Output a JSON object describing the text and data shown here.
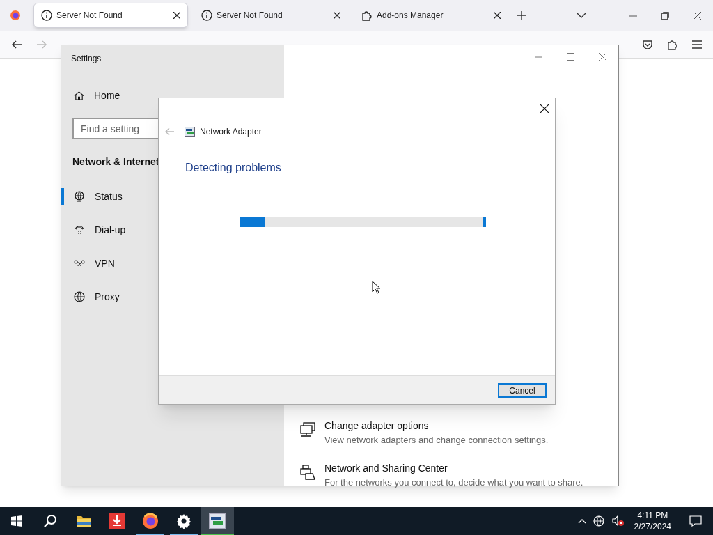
{
  "browser": {
    "tabs": [
      {
        "title": "Server Not Found",
        "kind": "info",
        "selected": true
      },
      {
        "title": "Server Not Found",
        "kind": "info",
        "selected": false
      },
      {
        "title": "Add-ons Manager",
        "kind": "puzzle",
        "selected": false
      }
    ]
  },
  "settings": {
    "title": "Settings",
    "home": "Home",
    "search": {
      "placeholder": "Find a setting"
    },
    "section": "Network & Internet",
    "items": [
      {
        "label": "Status",
        "kind": "globe-monitor",
        "selected": true
      },
      {
        "label": "Dial-up",
        "kind": "phone",
        "selected": false
      },
      {
        "label": "VPN",
        "kind": "vpn",
        "selected": false
      },
      {
        "label": "Proxy",
        "kind": "globe",
        "selected": false
      }
    ],
    "links": [
      {
        "title": "Change adapter options",
        "description": "View network adapters and change connection settings.",
        "kind": "monitors"
      },
      {
        "title": "Network and Sharing Center",
        "description": "For the networks you connect to, decide what you want to share.",
        "kind": "printer"
      }
    ]
  },
  "dialog": {
    "title": "Network Adapter",
    "heading": "Detecting problems",
    "progress": {
      "level": 0.1
    },
    "button": "Cancel"
  },
  "taskbar": {
    "apps": [
      {
        "kind": "folder",
        "running": false,
        "selected": false
      },
      {
        "kind": "download",
        "running": false,
        "selected": false
      },
      {
        "kind": "firefox",
        "running": true,
        "selected": false
      },
      {
        "kind": "gear",
        "running": true,
        "selected": false
      },
      {
        "kind": "network",
        "running": true,
        "selected": true
      }
    ],
    "time": "4:11 PM",
    "date": "2/27/2024"
  }
}
